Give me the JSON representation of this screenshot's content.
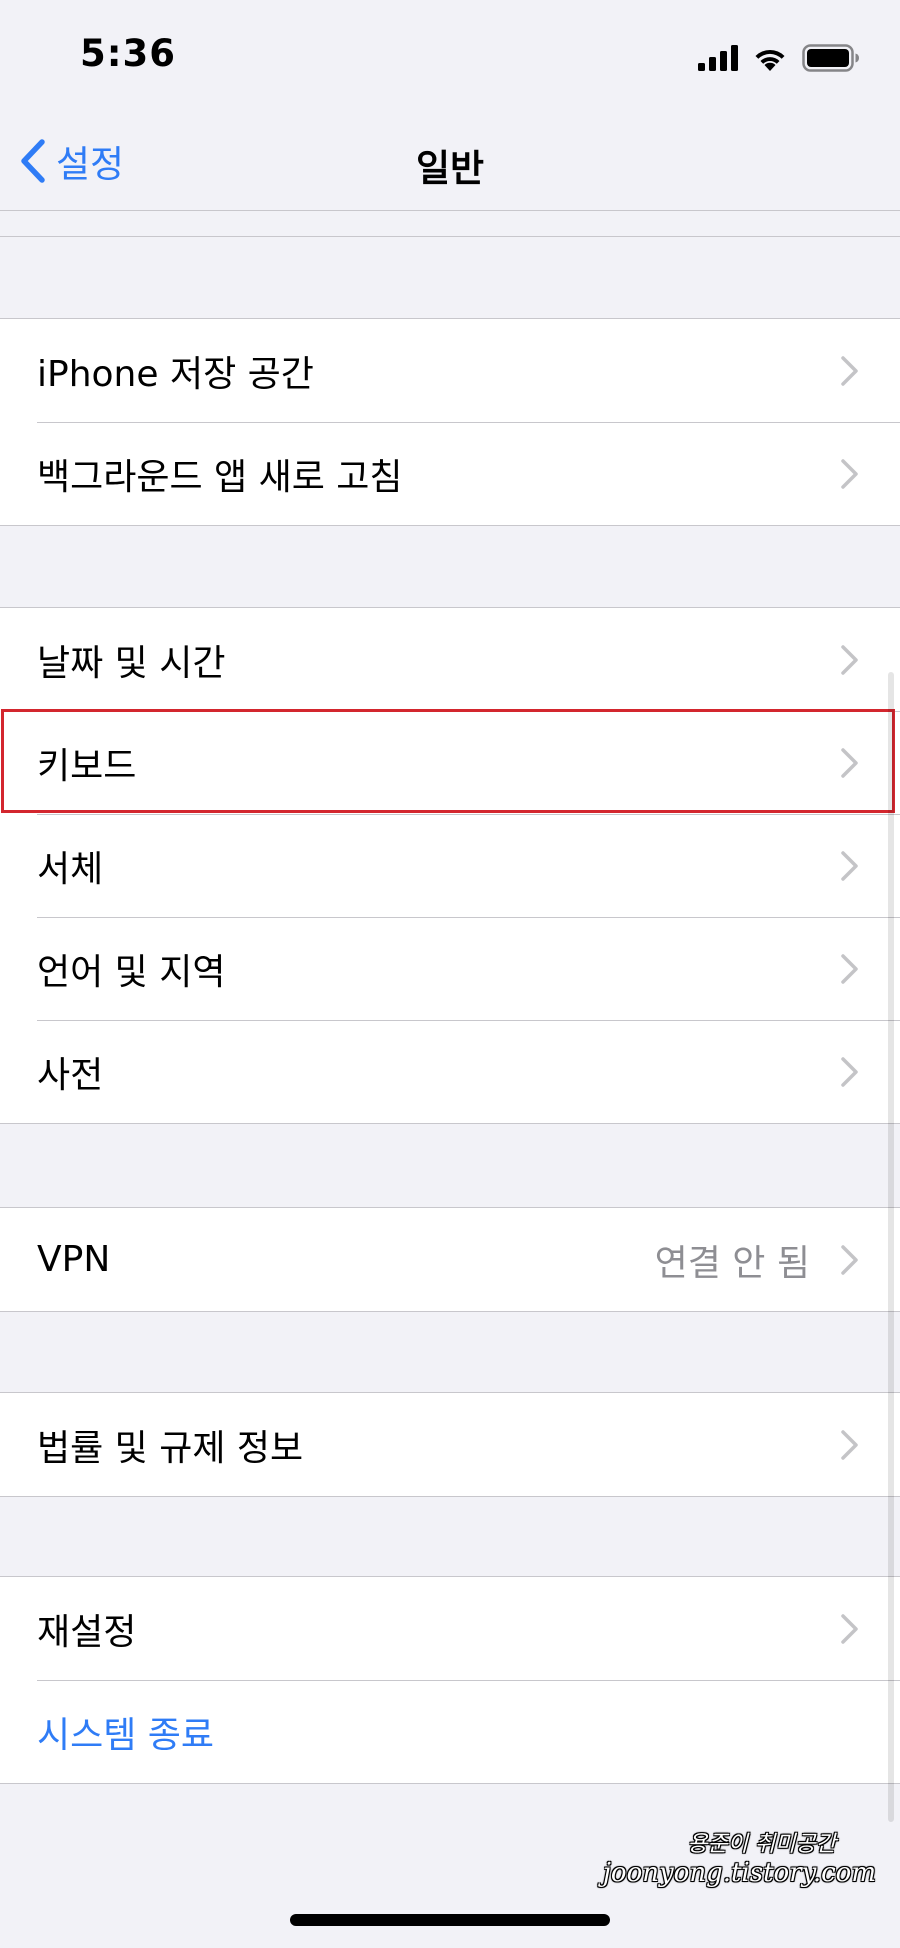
{
  "status_bar": {
    "time": "5:36",
    "icons": [
      "cellular-signal-icon",
      "wifi-icon",
      "battery-icon"
    ]
  },
  "navbar": {
    "back_label": "설정",
    "title": "일반"
  },
  "groups": [
    {
      "rows": [
        {
          "label": "iPhone 저장 공간"
        },
        {
          "label": "백그라운드 앱 새로 고침"
        }
      ]
    },
    {
      "rows": [
        {
          "label": "날짜 및 시간"
        },
        {
          "label": "키보드",
          "highlighted": true
        },
        {
          "label": "서체"
        },
        {
          "label": "언어 및 지역"
        },
        {
          "label": "사전"
        }
      ]
    },
    {
      "rows": [
        {
          "label": "VPN",
          "value": "연결 안 됨"
        }
      ]
    },
    {
      "rows": [
        {
          "label": "법률 및 규제 정보"
        }
      ]
    },
    {
      "rows": [
        {
          "label": "재설정"
        },
        {
          "label": "시스템 종료",
          "style": "action"
        }
      ]
    }
  ],
  "watermark": {
    "line1": "용준이 취미공간",
    "line2": "joonyong.tistory.com"
  },
  "colors": {
    "accent": "#2f7cf6",
    "background": "#f2f2f7",
    "highlight": "#d3262e",
    "secondary_text": "#8e8e93"
  }
}
